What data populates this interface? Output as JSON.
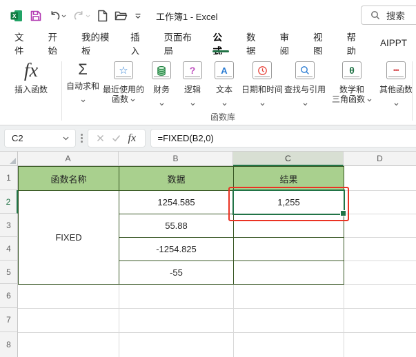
{
  "titlebar": {
    "title": "工作簿1 - Excel",
    "search_placeholder": "搜索"
  },
  "tabs": [
    {
      "label": "文件"
    },
    {
      "label": "开始"
    },
    {
      "label": "我的模板"
    },
    {
      "label": "插入"
    },
    {
      "label": "页面布局"
    },
    {
      "label": "公式",
      "active": true
    },
    {
      "label": "数据"
    },
    {
      "label": "审阅"
    },
    {
      "label": "视图"
    },
    {
      "label": "帮助"
    },
    {
      "label": "AIPPT"
    }
  ],
  "ribbon": {
    "group_label": "函数库",
    "buttons": [
      {
        "label": "插入函数"
      },
      {
        "label": "自动求和"
      },
      {
        "line1": "最近使用的",
        "line2": "函数"
      },
      {
        "label": "财务"
      },
      {
        "label": "逻辑"
      },
      {
        "label": "文本"
      },
      {
        "label": "日期和时间"
      },
      {
        "label": "查找与引用"
      },
      {
        "line1": "数学和",
        "line2": "三角函数"
      },
      {
        "label": "其他函数"
      }
    ]
  },
  "icons": {
    "fx": "fx",
    "sigma": "Σ",
    "star": "☆",
    "question": "?",
    "letter_a": "A",
    "theta": "θ",
    "dots": "•••"
  },
  "formula_bar": {
    "cell_ref": "C2",
    "formula": "=FIXED(B2,0)"
  },
  "sheet": {
    "columns": [
      "A",
      "B",
      "C",
      "D"
    ],
    "rows": [
      "1",
      "2",
      "3",
      "4",
      "5",
      "6",
      "7",
      "8"
    ],
    "selected_cell": "C2",
    "cells": {
      "a1": "函数名称",
      "b1": "数据",
      "c1": "结果",
      "a2": "FIXED",
      "b2": "1254.585",
      "b3": "55.88",
      "b4": "-1254.825",
      "b5": "-55",
      "c2": "1,255"
    }
  },
  "colors": {
    "accent_green": "#217346",
    "header_fill": "#A9D08E",
    "table_border": "#375623",
    "annotation_red": "#EA3323"
  }
}
